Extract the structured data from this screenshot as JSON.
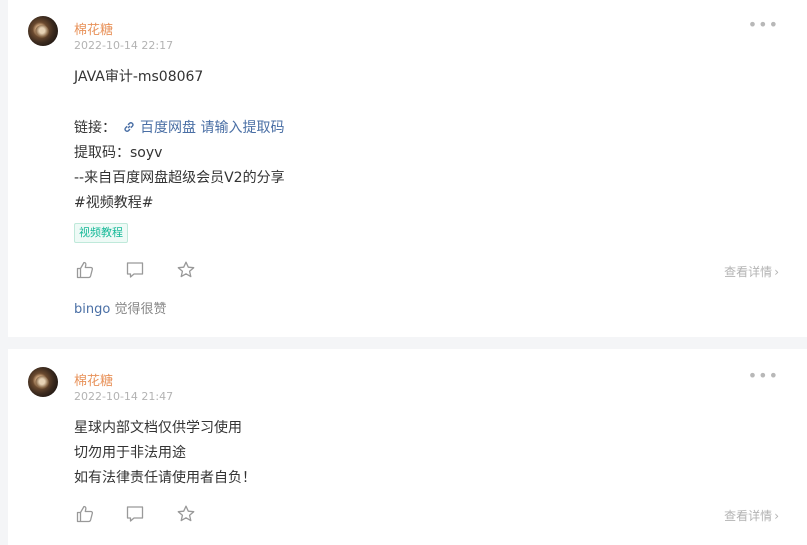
{
  "posts": [
    {
      "author": "棉花糖",
      "time": "2022-10-14 22:17",
      "title": "JAVA审计-ms08067",
      "link_prefix": "链接：",
      "link_text": "百度网盘 请输入提取码",
      "code_line": "提取码：soyv",
      "from_line": "--来自百度网盘超级会员V2的分享",
      "hashtag_line": "#视频教程#",
      "tag": "视频教程",
      "detail": "查看详情",
      "liker": "bingo",
      "liker_suffix": " 觉得很赞"
    },
    {
      "author": "棉花糖",
      "time": "2022-10-14 21:47",
      "lines": [
        "星球内部文档仅供学习使用",
        "切勿用于非法用途",
        "如有法律责任请使用者自负！"
      ],
      "detail": "查看详情"
    }
  ],
  "icons": {
    "more": "more-dots-icon",
    "like": "thumbs-up-icon",
    "comment": "comment-icon",
    "star": "star-icon",
    "link": "link-icon"
  }
}
